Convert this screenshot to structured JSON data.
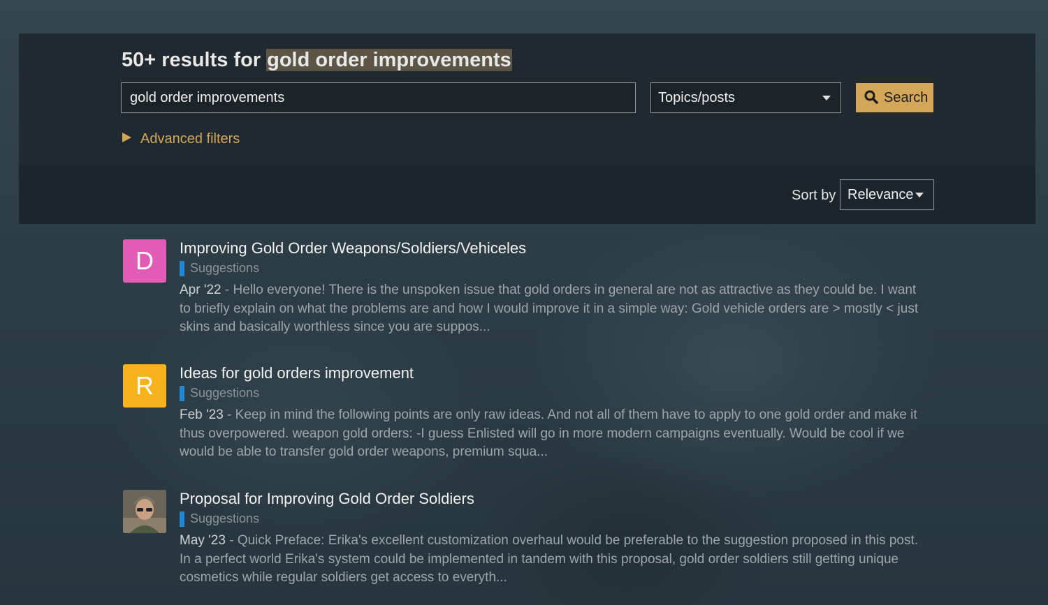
{
  "header": {
    "results_prefix": "50+ results for ",
    "query_highlight": "gold order improvements"
  },
  "search": {
    "input_value": "gold order improvements",
    "type_selected": "Topics/posts",
    "button_label": "Search",
    "advanced_filters_label": "Advanced filters"
  },
  "sort": {
    "label": "Sort by",
    "selected": "Relevance"
  },
  "colors": {
    "accent": "#d4a65a",
    "category_bar": "#1e88d8",
    "avatar_d": "#e25bb4",
    "avatar_r": "#f8b21c"
  },
  "results": [
    {
      "avatar_letter": "D",
      "title": "Improving Gold Order Weapons/Soldiers/Vehiceles",
      "category": "Suggestions",
      "date": "Apr '22",
      "blurb": " - Hello everyone! There is the unspoken issue that gold orders in general are not as attractive as they could be. I want to briefly explain on what the problems are and how I would improve it in a simple way: Gold vehicle orders are > mostly < just skins and basically worthless since you are suppos..."
    },
    {
      "avatar_letter": "R",
      "title": "Ideas for gold orders improvement",
      "category": "Suggestions",
      "date": "Feb '23",
      "blurb": " - Keep in mind the following points are only raw ideas. And not all of them have to apply to one gold order and make it thus overpowered. weapon gold orders: -I guess Enlisted will go in more modern campaigns eventually. Would be cool if we would be able to transfer gold order weapons, premium squa..."
    },
    {
      "avatar_letter": "",
      "title": "Proposal for Improving Gold Order Soldiers",
      "category": "Suggestions",
      "date": "May '23",
      "blurb": " - Quick Preface: Erika's excellent customization overhaul would be preferable to the suggestion proposed in this post. In a perfect world Erika's system could be implemented in tandem with this proposal, gold order soldiers still getting unique cosmetics while regular soldiers get access to everyth..."
    }
  ]
}
